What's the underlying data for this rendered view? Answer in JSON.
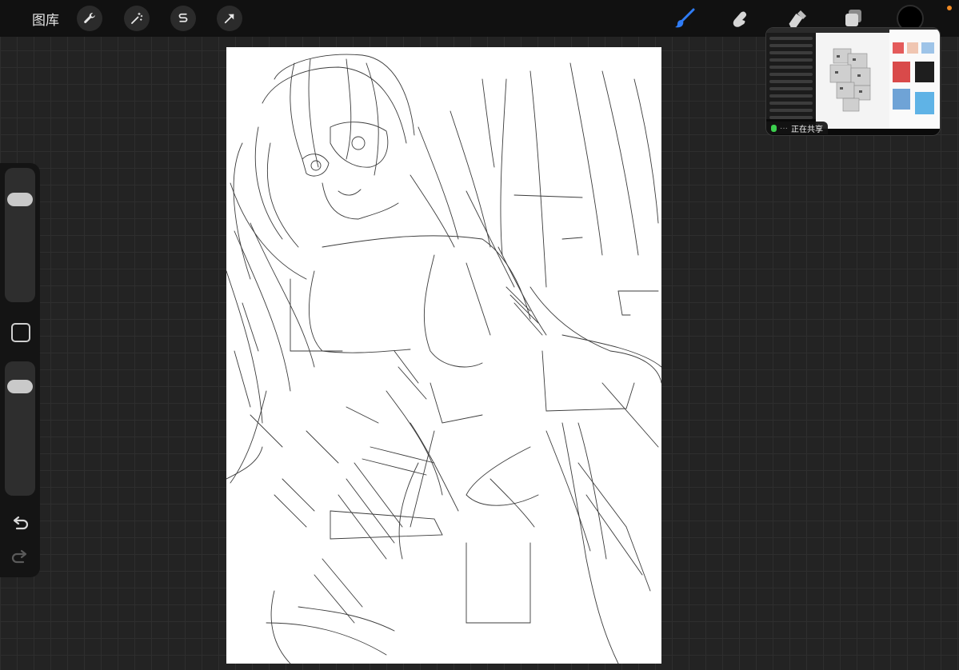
{
  "topbar": {
    "gallery_label": "图库",
    "left_tools": [
      "wrench-icon",
      "magic-wand-icon",
      "selection-s-icon",
      "transform-arrow-icon"
    ],
    "right_tools": [
      "brush-icon",
      "smudge-icon",
      "eraser-icon",
      "layers-icon"
    ],
    "active_tool": "brush-icon",
    "current_color": "#000000",
    "accent_color": "#2f7cf6"
  },
  "sidebar": {
    "brush_size_level": 0.85,
    "opacity_level": 0.85,
    "controls": [
      "modifier-square-icon",
      "undo-icon",
      "redo-icon"
    ]
  },
  "screen_share": {
    "status_label": "正在共享",
    "indicator_color": "#3ccf4e"
  }
}
